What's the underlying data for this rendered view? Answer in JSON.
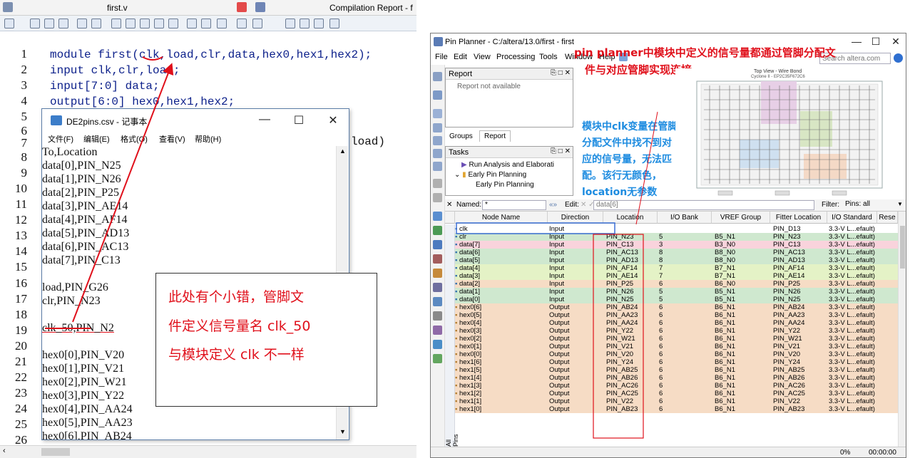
{
  "editor": {
    "tab_file": "first.v",
    "tab_report": "Compilation Report - f",
    "line_numbers": [
      "1",
      "2",
      "3",
      "4",
      "5",
      "6",
      "7",
      "8",
      "9",
      "10",
      "11",
      "12",
      "13",
      "14",
      "15",
      "16",
      "17",
      "18",
      "19",
      "20",
      "21",
      "22",
      "23",
      "24",
      "25",
      "26",
      "27"
    ],
    "code": [
      "module first(clk,load,clr,data,hex0,hex1,hex2);",
      "input clk,clr,load;",
      "input[7:0] data;",
      "output[6:0] hex0,hex1,hex2;"
    ],
    "code_tail": "load)"
  },
  "notepad": {
    "title": "DE2pins.csv - 记事本",
    "menu": [
      "文件(F)",
      "编辑(E)",
      "格式(O)",
      "查看(V)",
      "帮助(H)"
    ],
    "lines": [
      "To,Location",
      "data[0],PIN_N25",
      "data[1],PIN_N26",
      "data[2],PIN_P25",
      "data[3],PIN_AE14",
      "data[4],PIN_AF14",
      "data[5],PIN_AD13",
      "data[6],PIN_AC13",
      "data[7],PIN_C13",
      "",
      "load,PIN_G26",
      "clr,PIN_N23",
      "",
      "clk_50,PIN_N2",
      "",
      "hex0[0],PIN_V20",
      "hex0[1],PIN_V21",
      "hex0[2],PIN_W21",
      "hex0[3],PIN_Y22",
      "hex0[4],PIN_AA24",
      "hex0[5],PIN_AA23",
      "hex0[6],PIN_AB24"
    ]
  },
  "annotation_left": [
    "此处有个小错，管脚文",
    "件定义信号量名 clk_50",
    "与模块定义 clk 不一样"
  ],
  "pin_planner": {
    "title": "Pin Planner - C:/altera/13.0/first - first",
    "menu": [
      "File",
      "Edit",
      "View",
      "Processing",
      "Tools",
      "Window",
      "Help"
    ],
    "search_placeholder": "Search altera.com",
    "report_pane_title": "Report",
    "report_empty": "Report not available",
    "tab_groups": "Groups",
    "tab_report": "Report",
    "tasks_title": "Tasks",
    "tasks": [
      "Run Analysis and Elaborati",
      "Early Pin Planning",
      "Early Pin Planning"
    ],
    "chip_title": "Top View - Wire Bond",
    "chip_subtitle": "Cyclone II - EP2C35F672C6",
    "named_label": "Named:",
    "named_value": "*",
    "edit_label": "Edit:",
    "edit_value": "data[6]",
    "filter_label": "Filter:",
    "filter_value": "Pins: all",
    "side_tab": "All Pins",
    "columns": [
      "Node Name",
      "Direction",
      "Location",
      "I/O Bank",
      "VREF Group",
      "Fitter Location",
      "I/O Standard",
      "Rese"
    ],
    "rows": [
      {
        "name": "clk",
        "dir": "Input",
        "loc": "",
        "bank": "",
        "vref": "",
        "fit": "PIN_D13",
        "std": "3.3-V L...efault)",
        "color": "#ffffff"
      },
      {
        "name": "clr",
        "dir": "Input",
        "loc": "PIN_N23",
        "bank": "5",
        "vref": "B5_N1",
        "fit": "PIN_N23",
        "std": "3.3-V L...efault)",
        "color": "#cfe8cf"
      },
      {
        "name": "data[7]",
        "dir": "Input",
        "loc": "PIN_C13",
        "bank": "3",
        "vref": "B3_N0",
        "fit": "PIN_C13",
        "std": "3.3-V L...efault)",
        "color": "#f9d3dc"
      },
      {
        "name": "data[6]",
        "dir": "Input",
        "loc": "PIN_AC13",
        "bank": "8",
        "vref": "B8_N0",
        "fit": "PIN_AC13",
        "std": "3.3-V L...efault)",
        "color": "#cfe8cf"
      },
      {
        "name": "data[5]",
        "dir": "Input",
        "loc": "PIN_AD13",
        "bank": "8",
        "vref": "B8_N0",
        "fit": "PIN_AD13",
        "std": "3.3-V L...efault)",
        "color": "#cfe8cf"
      },
      {
        "name": "data[4]",
        "dir": "Input",
        "loc": "PIN_AF14",
        "bank": "7",
        "vref": "B7_N1",
        "fit": "PIN_AF14",
        "std": "3.3-V L...efault)",
        "color": "#e4f2c6"
      },
      {
        "name": "data[3]",
        "dir": "Input",
        "loc": "PIN_AE14",
        "bank": "7",
        "vref": "B7_N1",
        "fit": "PIN_AE14",
        "std": "3.3-V L...efault)",
        "color": "#e4f2c6"
      },
      {
        "name": "data[2]",
        "dir": "Input",
        "loc": "PIN_P25",
        "bank": "6",
        "vref": "B6_N0",
        "fit": "PIN_P25",
        "std": "3.3-V L...efault)",
        "color": "#f6dcc5"
      },
      {
        "name": "data[1]",
        "dir": "Input",
        "loc": "PIN_N26",
        "bank": "5",
        "vref": "B5_N1",
        "fit": "PIN_N26",
        "std": "3.3-V L...efault)",
        "color": "#cfe8cf"
      },
      {
        "name": "data[0]",
        "dir": "Input",
        "loc": "PIN_N25",
        "bank": "5",
        "vref": "B5_N1",
        "fit": "PIN_N25",
        "std": "3.3-V L...efault)",
        "color": "#cfe8cf"
      },
      {
        "name": "hex0[6]",
        "dir": "Output",
        "loc": "PIN_AB24",
        "bank": "6",
        "vref": "B6_N1",
        "fit": "PIN_AB24",
        "std": "3.3-V L...efault)",
        "color": "#f6dcc5"
      },
      {
        "name": "hex0[5]",
        "dir": "Output",
        "loc": "PIN_AA23",
        "bank": "6",
        "vref": "B6_N1",
        "fit": "PIN_AA23",
        "std": "3.3-V L...efault)",
        "color": "#f6dcc5"
      },
      {
        "name": "hex0[4]",
        "dir": "Output",
        "loc": "PIN_AA24",
        "bank": "6",
        "vref": "B6_N1",
        "fit": "PIN_AA24",
        "std": "3.3-V L...efault)",
        "color": "#f6dcc5"
      },
      {
        "name": "hex0[3]",
        "dir": "Output",
        "loc": "PIN_Y22",
        "bank": "6",
        "vref": "B6_N1",
        "fit": "PIN_Y22",
        "std": "3.3-V L...efault)",
        "color": "#f6dcc5"
      },
      {
        "name": "hex0[2]",
        "dir": "Output",
        "loc": "PIN_W21",
        "bank": "6",
        "vref": "B6_N1",
        "fit": "PIN_W21",
        "std": "3.3-V L...efault)",
        "color": "#f6dcc5"
      },
      {
        "name": "hex0[1]",
        "dir": "Output",
        "loc": "PIN_V21",
        "bank": "6",
        "vref": "B6_N1",
        "fit": "PIN_V21",
        "std": "3.3-V L...efault)",
        "color": "#f6dcc5"
      },
      {
        "name": "hex0[0]",
        "dir": "Output",
        "loc": "PIN_V20",
        "bank": "6",
        "vref": "B6_N1",
        "fit": "PIN_V20",
        "std": "3.3-V L...efault)",
        "color": "#f6dcc5"
      },
      {
        "name": "hex1[6]",
        "dir": "Output",
        "loc": "PIN_Y24",
        "bank": "6",
        "vref": "B6_N1",
        "fit": "PIN_Y24",
        "std": "3.3-V L...efault)",
        "color": "#f6dcc5"
      },
      {
        "name": "hex1[5]",
        "dir": "Output",
        "loc": "PIN_AB25",
        "bank": "6",
        "vref": "B6_N1",
        "fit": "PIN_AB25",
        "std": "3.3-V L...efault)",
        "color": "#f6dcc5"
      },
      {
        "name": "hex1[4]",
        "dir": "Output",
        "loc": "PIN_AB26",
        "bank": "6",
        "vref": "B6_N1",
        "fit": "PIN_AB26",
        "std": "3.3-V L...efault)",
        "color": "#f6dcc5"
      },
      {
        "name": "hex1[3]",
        "dir": "Output",
        "loc": "PIN_AC26",
        "bank": "6",
        "vref": "B6_N1",
        "fit": "PIN_AC26",
        "std": "3.3-V L...efault)",
        "color": "#f6dcc5"
      },
      {
        "name": "hex1[2]",
        "dir": "Output",
        "loc": "PIN_AC25",
        "bank": "6",
        "vref": "B6_N1",
        "fit": "PIN_AC25",
        "std": "3.3-V L...efault)",
        "color": "#f6dcc5"
      },
      {
        "name": "hex1[1]",
        "dir": "Output",
        "loc": "PIN_V22",
        "bank": "6",
        "vref": "B6_N1",
        "fit": "PIN_V22",
        "std": "3.3-V L...efault)",
        "color": "#f6dcc5"
      },
      {
        "name": "hex1[0]",
        "dir": "Output",
        "loc": "PIN_AB23",
        "bank": "6",
        "vref": "B6_N1",
        "fit": "PIN_AB23",
        "std": "3.3-V L...efault)",
        "color": "#f6dcc5"
      }
    ],
    "status_percent": "0%",
    "status_time": "00:00:00"
  },
  "annotation_right_top": [
    "pin planner中模块中定义的信号量都通过管脚分配文",
    "件与对应管脚实现连接"
  ],
  "annotation_right_blue": [
    "模块中clk变量在管脚",
    "分配文件中找不到对",
    "应的信号量，无法匹",
    "配。该行无颜色，",
    "location无参数"
  ]
}
